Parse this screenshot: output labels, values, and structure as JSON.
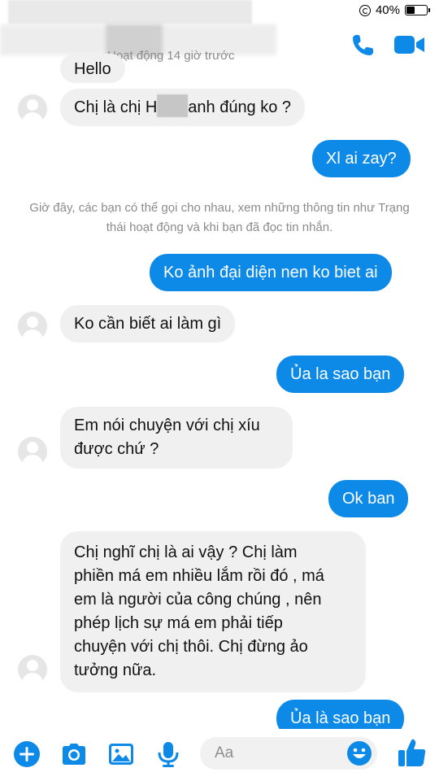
{
  "status_bar": {
    "battery_percent_text": "40%",
    "battery_level": 0.4,
    "icons": [
      "screen-rotation-lock-icon",
      "battery-icon"
    ]
  },
  "header": {
    "active_status": "Hoạt động 14 giờ trước",
    "actions": [
      {
        "name": "call-icon",
        "label": "Call"
      },
      {
        "name": "video-call-icon",
        "label": "Video call"
      }
    ]
  },
  "colors": {
    "accent": "#0d8ae8",
    "incoming_bubble": "#f1f0f0",
    "system_text": "#8b8b8b"
  },
  "messages": [
    {
      "side": "in",
      "text": "Hello"
    },
    {
      "side": "in",
      "text_before": "Chị là chị H",
      "text_after": "anh đúng ko ?"
    },
    {
      "side": "out",
      "text": "Xl ai zay?"
    },
    {
      "side": "system",
      "text": "Giờ đây, các bạn có thể gọi cho nhau, xem những thông tin như Trạng thái hoạt động và khi bạn đã đọc tin nhắn."
    },
    {
      "side": "out",
      "text": "Ko ảnh đại diện nen ko biet ai"
    },
    {
      "side": "in",
      "text": "Ko cần biết ai làm gì"
    },
    {
      "side": "out",
      "text": "Ủa la sao bạn"
    },
    {
      "side": "in",
      "lines": [
        "Em nói chuyện với chị xíu",
        "được chứ ?"
      ]
    },
    {
      "side": "out",
      "text": "Ok ban"
    },
    {
      "side": "in",
      "lines": [
        "Chị nghĩ chị là ai vậy ? Chị làm",
        "phiền má em nhiều lắm rồi đó , má",
        "em là người của công chúng , nên",
        "phép lịch sự má em phải tiếp",
        "chuyện với chị thôi. Chị đừng ảo",
        "tưởng nữa."
      ]
    },
    {
      "side": "out",
      "text": "Ủa là sao bạn"
    }
  ],
  "composer": {
    "placeholder": "Aa",
    "icons": [
      "plus-icon",
      "camera-icon",
      "image-icon",
      "microphone-icon",
      "emoji-icon",
      "thumbs-up-icon"
    ]
  }
}
